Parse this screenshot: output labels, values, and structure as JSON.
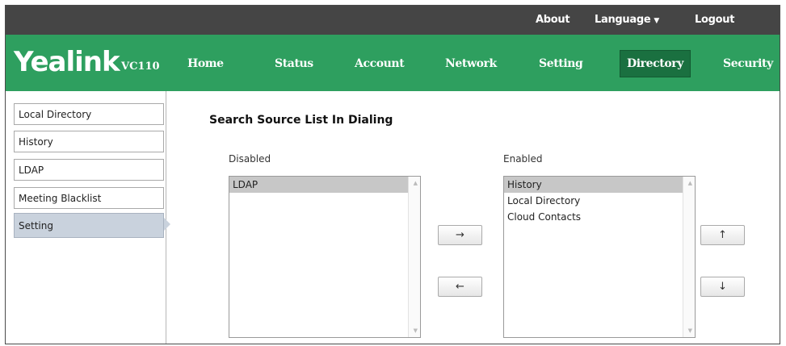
{
  "topbar": {
    "about": "About",
    "language": "Language",
    "logout": "Logout"
  },
  "brand": {
    "logo": "Yealink",
    "model": "VC110"
  },
  "nav": {
    "items": [
      "Home",
      "Status",
      "Account",
      "Network",
      "Setting",
      "Directory",
      "Security"
    ],
    "active": "Directory"
  },
  "sidebar": {
    "items": [
      "Local Directory",
      "History",
      "LDAP",
      "Meeting Blacklist",
      "Setting"
    ],
    "active": "Setting"
  },
  "main": {
    "heading": "Search Source List In Dialing",
    "disabled_label": "Disabled",
    "enabled_label": "Enabled",
    "disabled_items": [
      "LDAP"
    ],
    "enabled_items": [
      "History",
      "Local Directory",
      "Cloud Contacts"
    ],
    "buttons": {
      "move_right": "→",
      "move_left": "←",
      "move_up": "↑",
      "move_down": "↓"
    }
  }
}
